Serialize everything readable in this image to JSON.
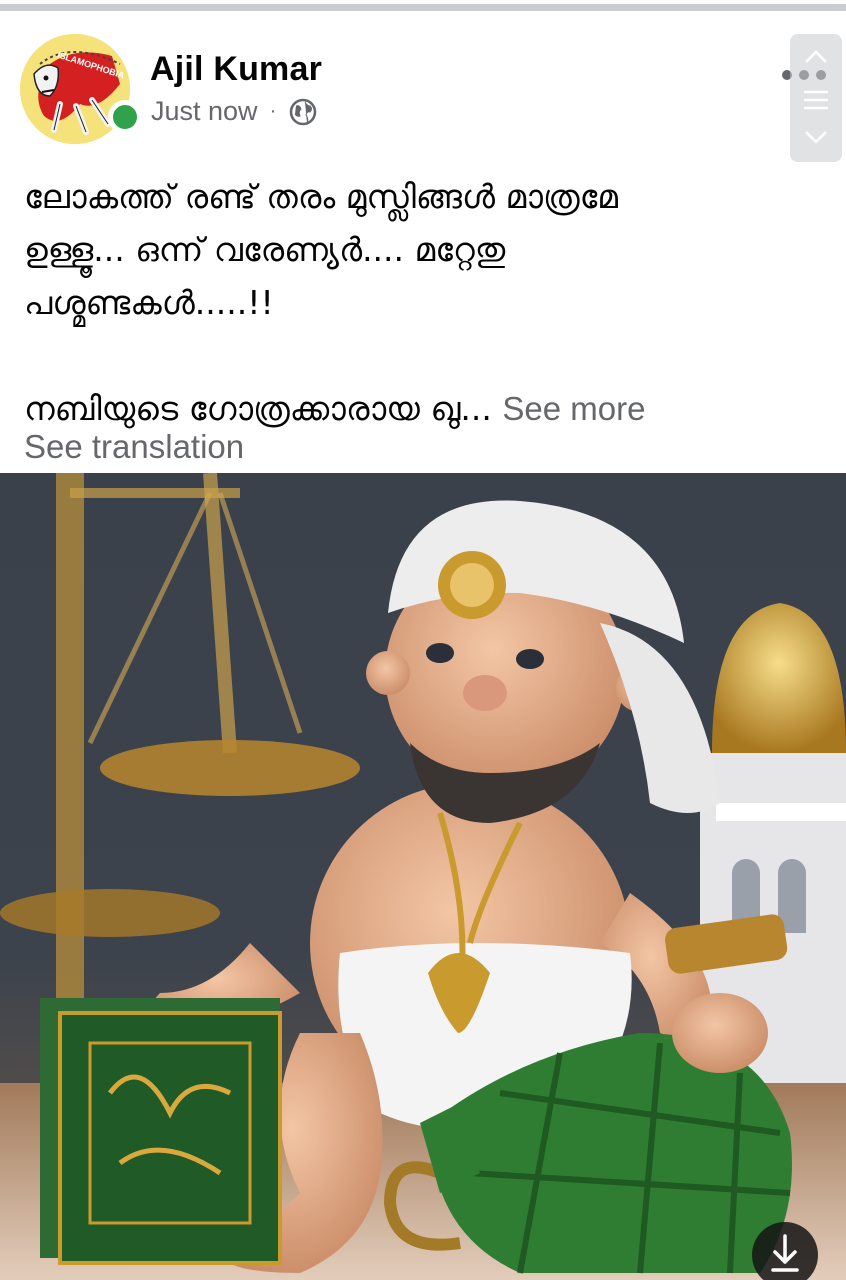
{
  "post": {
    "author": "Ajil Kumar",
    "timestamp": "Just now",
    "separator": "·",
    "audience_icon": "globe-icon",
    "avatar_text": "ISLAMOPHOBIA",
    "text_lines": [
      "ലോകത്ത് രണ്ട് തരം മുസ്ലിങ്ങൾ മാത്രമേ",
      "ഉള്ളൂ... ഒന്ന് വരേണ്യർ.... മറ്റേതു",
      "പശ്മണ്ടകൾ.....!!"
    ],
    "truncated_line": "നബിയുടെ ഗോത്രക്കാരായ ഖു...",
    "see_more": "See more",
    "see_translation": "See translation"
  },
  "icons": {
    "more": "more-horizontal-icon",
    "download": "download-icon",
    "scroll": "scroll-arrows-icon"
  },
  "colors": {
    "online": "#31a24c",
    "secondary_text": "#65676b",
    "primary_text": "#050505",
    "avatar_bg": "#f6e27a",
    "grenade_green": "#2f7d32",
    "gold": "#c99a2e"
  }
}
